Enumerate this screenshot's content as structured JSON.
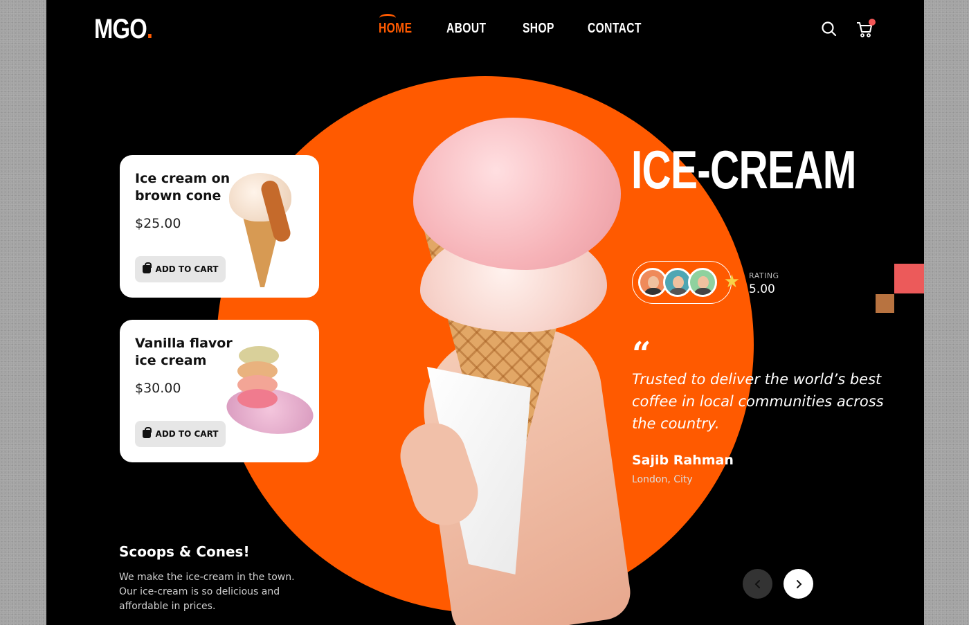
{
  "brand": {
    "logo": "MGO",
    "logo_dot": ".",
    "accent_color": "#ff5a00"
  },
  "nav": {
    "items": [
      {
        "label": "HOME",
        "active": true
      },
      {
        "label": "ABOUT",
        "active": false
      },
      {
        "label": "SHOP",
        "active": false
      },
      {
        "label": "CONTACT",
        "active": false
      }
    ],
    "search_icon": "search-icon",
    "cart_icon": "cart-icon"
  },
  "products": [
    {
      "title": "Ice cream on brown cone",
      "price": "$25.00",
      "button": "ADD TO CART"
    },
    {
      "title": "Vanilla flavor ice cream",
      "price": "$30.00",
      "button": "ADD TO CART"
    }
  ],
  "hero": {
    "headline": "ICE-CREAM"
  },
  "rating": {
    "label": "RATING",
    "value": "5.00"
  },
  "testimonial": {
    "quote": "Trusted to deliver the world’s best coffee in local communities across the country.",
    "author": "Sajib Rahman",
    "location": "London, City"
  },
  "about": {
    "title": "Scoops & Cones!",
    "description": "We make the ice-cream in the town. Our ice-cream is so delicious and affordable in prices."
  },
  "carousel": {
    "prev_icon": "chevron-left-icon",
    "next_icon": "chevron-right-icon"
  }
}
